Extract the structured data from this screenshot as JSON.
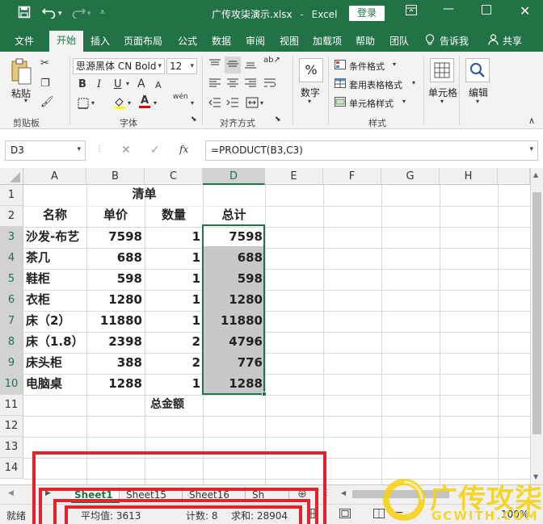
{
  "app": {
    "document_title": "广传攻柒演示.xlsx",
    "app_name": "Excel",
    "separator": "-",
    "login_label": "登录"
  },
  "ribbon_tabs": [
    "文件",
    "开始",
    "插入",
    "页面布局",
    "公式",
    "数据",
    "审阅",
    "视图",
    "加载项",
    "帮助",
    "团队"
  ],
  "ribbon_tabs_right": {
    "tell_me": "告诉我",
    "share": "共享"
  },
  "ribbon": {
    "clipboard": {
      "paste_label": "粘贴",
      "group_label": "剪贴板"
    },
    "font": {
      "font_name": "思源黑体 CN Bold",
      "font_size": "12",
      "group_label": "字体",
      "bold": "B",
      "italic": "I",
      "underline": "U",
      "grow": "A",
      "shrink": "A",
      "font_color_letter": "A",
      "phonetic": "wén"
    },
    "alignment": {
      "group_label": "对齐方式"
    },
    "number": {
      "label": "数字",
      "symbol": "%"
    },
    "styles": {
      "conditional": "条件格式",
      "table_format": "套用表格格式",
      "cell_styles": "单元格样式",
      "group_label": "样式"
    },
    "cells": {
      "label": "单元格"
    },
    "editing": {
      "label": "编辑"
    }
  },
  "formula_bar": {
    "name_box": "D3",
    "fx_label": "fx",
    "formula": "=PRODUCT(B3,C3)"
  },
  "columns": [
    "A",
    "B",
    "C",
    "D",
    "E",
    "F",
    "G",
    "H"
  ],
  "rows": [
    "1",
    "2",
    "3",
    "4",
    "5",
    "6",
    "7",
    "8",
    "9",
    "10",
    "11",
    "12",
    "13",
    "14"
  ],
  "sheet": {
    "title": "清单",
    "headers": [
      "名称",
      "单价",
      "数量",
      "总计"
    ],
    "items": [
      {
        "name": "沙发-布艺",
        "price": "7598",
        "qty": "1",
        "total": "7598"
      },
      {
        "name": "茶几",
        "price": "688",
        "qty": "1",
        "total": "688"
      },
      {
        "name": "鞋柜",
        "price": "598",
        "qty": "1",
        "total": "598"
      },
      {
        "name": "衣柜",
        "price": "1280",
        "qty": "1",
        "total": "1280"
      },
      {
        "name": "床（2）",
        "price": "11880",
        "qty": "1",
        "total": "11880"
      },
      {
        "name": "床（1.8）",
        "price": "2398",
        "qty": "2",
        "total": "4796"
      },
      {
        "name": "床头柜",
        "price": "388",
        "qty": "2",
        "total": "776"
      },
      {
        "name": "电脑桌",
        "price": "1288",
        "qty": "1",
        "total": "1288"
      }
    ],
    "total_label": "总金额"
  },
  "sheet_tabs": [
    "Sheet1",
    "Sheet15",
    "Sheet16",
    "Sh"
  ],
  "status": {
    "ready": "就绪",
    "average": "平均值: 3613",
    "count": "计数: 8",
    "sum": "求和: 28904",
    "zoom": "100%"
  },
  "watermark": {
    "text": "广传攻柒",
    "url": "GCWITH.COM"
  },
  "colors": {
    "excel_green": "#217346",
    "selection_fill": "#c8c8c8",
    "annotation_red": "#e3232c",
    "watermark_yellow": "#f5d31a"
  }
}
